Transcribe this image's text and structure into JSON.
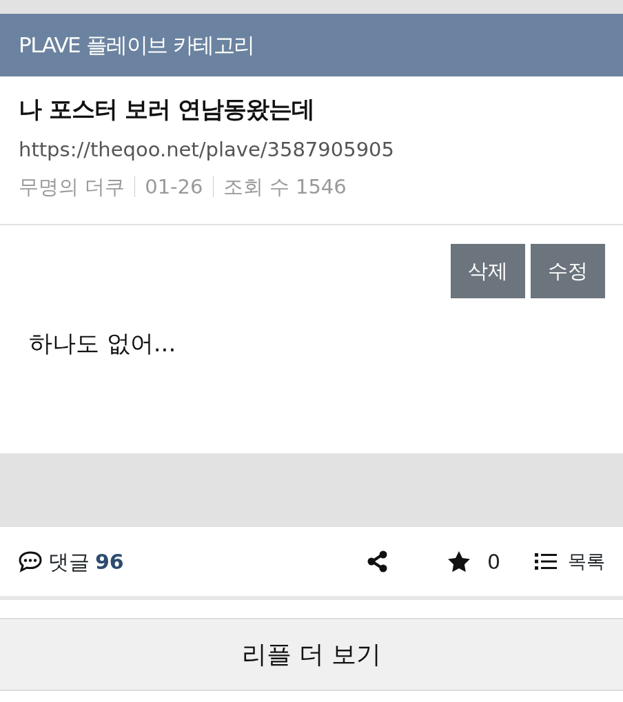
{
  "category": "PLAVE 플레이브 카테고리",
  "post": {
    "title": "나 포스터 보러 연남동왔는데",
    "url": "https://theqoo.net/plave/3587905905",
    "meta": [
      "무명의 더쿠",
      "01-26",
      "조회 수 1546"
    ]
  },
  "actions": [
    "삭제",
    "수정"
  ],
  "body": "하나도 없어...",
  "comment": {
    "label": "댓글",
    "count": "96"
  },
  "star_count": "0",
  "list_label": "목록",
  "more_button": "리플 더 보기"
}
